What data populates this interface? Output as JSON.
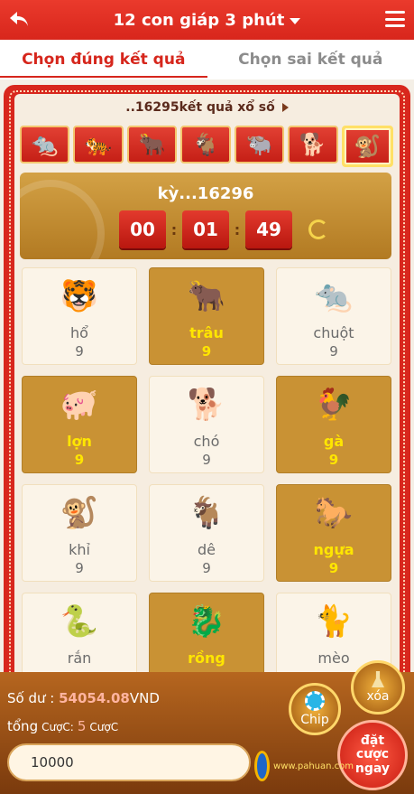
{
  "header": {
    "title": "12 con giáp 3 phút"
  },
  "tabs": [
    {
      "label": "Chọn đúng kết quả",
      "active": true
    },
    {
      "label": "Chọn sai kết quả",
      "active": false
    }
  ],
  "lottery": {
    "title": "..16295kết quả xổ số"
  },
  "strip": [
    {
      "icon": "rat-icon",
      "active": false
    },
    {
      "icon": "tiger-icon",
      "active": false
    },
    {
      "icon": "ox-icon",
      "active": false
    },
    {
      "icon": "goat-icon",
      "active": false
    },
    {
      "icon": "ox-icon",
      "active": false
    },
    {
      "icon": "dog-icon",
      "active": false
    },
    {
      "icon": "monkey-icon",
      "active": true
    }
  ],
  "timer": {
    "period": "kỳ...16296",
    "hours": "00",
    "minutes": "01",
    "seconds": "49"
  },
  "cells": [
    {
      "name": "hổ",
      "odds": "9",
      "selected": false,
      "icon": "tiger-icon",
      "glyph": "🐯"
    },
    {
      "name": "trâu",
      "odds": "9",
      "selected": true,
      "icon": "ox-icon",
      "glyph": "🐂"
    },
    {
      "name": "chuột",
      "odds": "9",
      "selected": false,
      "icon": "rat-icon",
      "glyph": "🐀"
    },
    {
      "name": "lợn",
      "odds": "9",
      "selected": true,
      "icon": "pig-icon",
      "glyph": "🐖"
    },
    {
      "name": "chó",
      "odds": "9",
      "selected": false,
      "icon": "dog-icon",
      "glyph": "🐕"
    },
    {
      "name": "gà",
      "odds": "9",
      "selected": true,
      "icon": "rooster-icon",
      "glyph": "🐓"
    },
    {
      "name": "khỉ",
      "odds": "9",
      "selected": false,
      "icon": "monkey-icon",
      "glyph": "🐒"
    },
    {
      "name": "dê",
      "odds": "9",
      "selected": false,
      "icon": "goat-icon",
      "glyph": "🐐"
    },
    {
      "name": "ngựa",
      "odds": "9",
      "selected": true,
      "icon": "horse-icon",
      "glyph": "🐎"
    },
    {
      "name": "rắn",
      "odds": "",
      "selected": false,
      "icon": "snake-icon",
      "glyph": "🐍"
    },
    {
      "name": "rồng",
      "odds": "",
      "selected": true,
      "icon": "dragon-icon",
      "glyph": "🐉"
    },
    {
      "name": "mèo",
      "odds": "",
      "selected": false,
      "icon": "cat-icon",
      "glyph": "🐈"
    }
  ],
  "bottom": {
    "balance_label": "Số dư :",
    "balance_value": "54054.08",
    "balance_unit": "VND",
    "total_label": "tổng",
    "total_prefix": "CượC:",
    "total_count": "5",
    "total_suffix": "CượC",
    "amount": "10000",
    "chip_label": "Chip",
    "clear_label": "xóa",
    "bet_label": "đặt cược ngay"
  },
  "watermark": {
    "text": "www.pahuan.com"
  },
  "colors": {
    "brand_red": "#d8261c",
    "gold": "#c99234",
    "selected_text": "#ffe600"
  }
}
